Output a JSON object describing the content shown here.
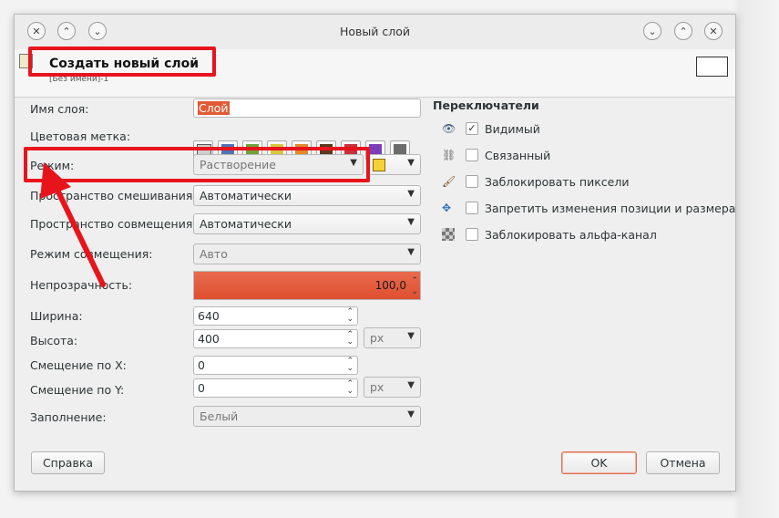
{
  "window": {
    "title": "Новый слой",
    "close_glyph": "✕",
    "up_glyph": "⌃",
    "down_glyph": "⌄"
  },
  "header": {
    "title": "Создать новый слой",
    "subtitle": "[Без имени]-1"
  },
  "form": {
    "layer_name_label": "Имя слоя:",
    "layer_name_value": "Слой",
    "color_tag_label": "Цветовая метка:",
    "color_tags": [
      "#cfcfcf",
      "#4f74b8",
      "#6fa23a",
      "#d9c73a",
      "#e08a2a",
      "#5b3a1c",
      "#c7313a",
      "#7b3fb5",
      "#6c6c6c"
    ],
    "mode_label": "Режим:",
    "mode_value": "Растворение",
    "blend_space_label": "Пространство смешивания:",
    "blend_space_value": "Автоматически",
    "composite_space_label": "Пространство совмещения:",
    "composite_space_value": "Автоматически",
    "composite_mode_label": "Режим совмещения:",
    "composite_mode_value": "Авто",
    "opacity_label": "Непрозрачность:",
    "opacity_value": "100,0",
    "opacity_fraction": 1.0,
    "width_label": "Ширина:",
    "width_value": "640",
    "height_label": "Высота:",
    "height_value": "400",
    "offset_x_label": "Смещение по X:",
    "offset_x_value": "0",
    "offset_y_label": "Смещение по Y:",
    "offset_y_value": "0",
    "unit_value": "px",
    "fill_label": "Заполнение:",
    "fill_value": "Белый"
  },
  "switches": {
    "title": "Переключатели",
    "items": [
      {
        "label": "Видимый",
        "checked": "✓",
        "icon": "eye-icon"
      },
      {
        "label": "Связанный",
        "checked": "",
        "icon": "chain-icon"
      },
      {
        "label": "Заблокировать пиксели",
        "checked": "",
        "icon": "brush-icon"
      },
      {
        "label": "Запретить изменения позиции и размера",
        "checked": "",
        "icon": "move-icon"
      },
      {
        "label": "Заблокировать альфа-канал",
        "checked": "",
        "icon": "checkerboard-icon"
      }
    ]
  },
  "buttons": {
    "help": "Справка",
    "ok": "OK",
    "cancel": "Отмена"
  },
  "accent": {
    "annotation_red": "#e8141c",
    "opacity_fill": "#e2573a"
  }
}
